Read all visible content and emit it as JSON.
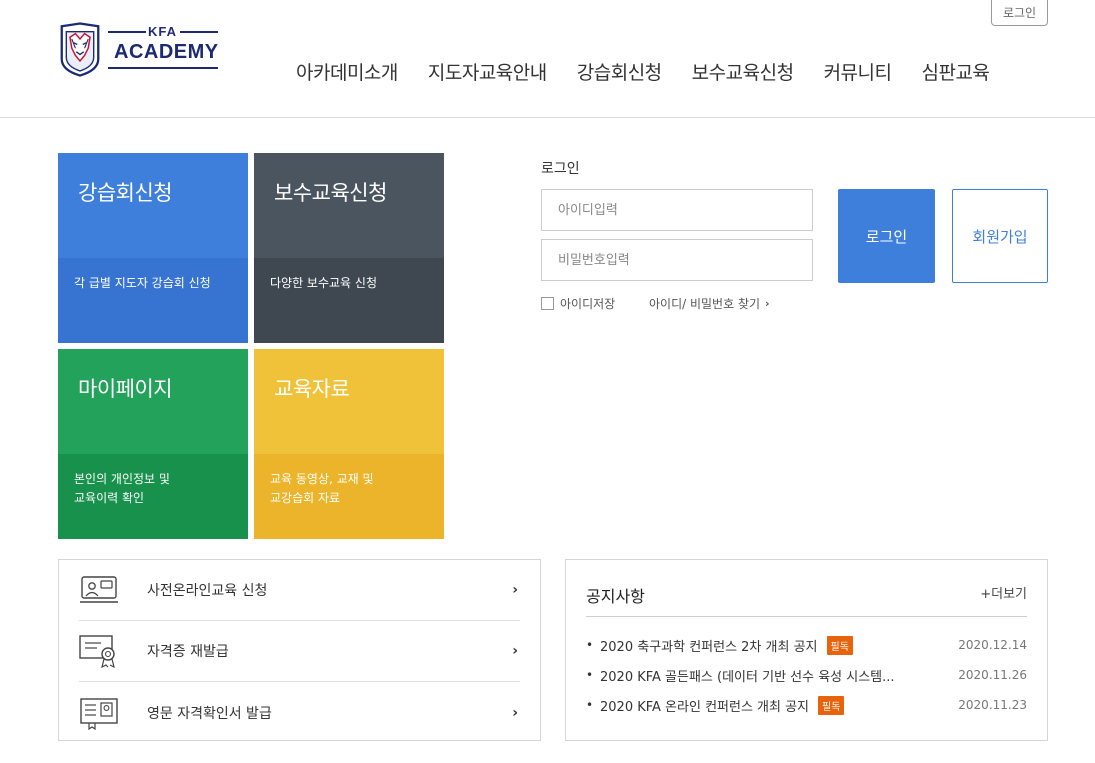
{
  "header": {
    "top_login": "로그인",
    "logo_small": "KFA",
    "logo_big": "ACADEMY",
    "nav": [
      "아카데미소개",
      "지도자교육안내",
      "강습회신청",
      "보수교육신청",
      "커뮤니티",
      "심판교육"
    ]
  },
  "tiles": [
    {
      "title": "강습회신청",
      "desc": "각 급별 지도자 강습회 신청",
      "color": "#3f7fdc"
    },
    {
      "title": "보수교육신청",
      "desc": "다양한 보수교육 신청",
      "color": "#4a5560"
    },
    {
      "title": "마이페이지",
      "desc_l1": "본인의 개인정보 및",
      "desc_l2": "교육이력 확인",
      "color": "#22a25a"
    },
    {
      "title": "교육자료",
      "desc_l1": "교육 동영상, 교재 및",
      "desc_l2": "교강습회 자료",
      "color": "#efc23a"
    }
  ],
  "login": {
    "title": "로그인",
    "id_placeholder": "아이디입력",
    "pw_placeholder": "비밀번호입력",
    "login_button": "로그인",
    "join_button": "회원가입",
    "save_id": "아이디저장",
    "find_link": "아이디/ 비밀번호 찾기"
  },
  "services": [
    {
      "label": "사전온라인교육 신청",
      "icon": "online-lecture-icon"
    },
    {
      "label": "자격증 재발급",
      "icon": "certificate-icon"
    },
    {
      "label": "영문 자격확인서 발급",
      "icon": "document-icon"
    }
  ],
  "notice": {
    "title": "공지사항",
    "more": "+더보기",
    "items": [
      {
        "text": "2020 축구과학 컨퍼런스 2차 개최 공지",
        "badge": "필독",
        "date": "2020.12.14"
      },
      {
        "text": "2020 KFA 골든패스 (데이터 기반 선수 육성 시스템...",
        "badge": "",
        "date": "2020.11.26"
      },
      {
        "text": "2020 KFA 온라인 컨퍼런스 개최 공지",
        "badge": "필독",
        "date": "2020.11.23"
      }
    ]
  },
  "colors": {
    "accent": "#3f7fdc",
    "badge": "#e8640c",
    "navy": "#1c2a73"
  }
}
